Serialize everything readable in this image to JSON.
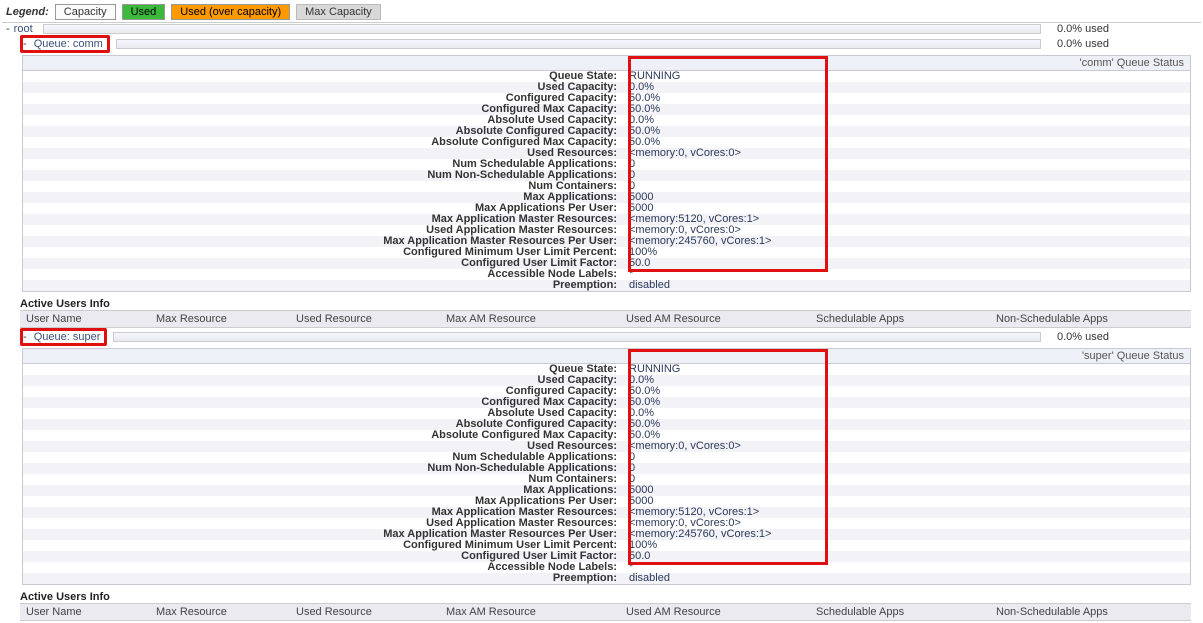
{
  "legend": {
    "title": "Legend:",
    "chips": {
      "capacity": "Capacity",
      "used": "Used",
      "over": "Used (over capacity)",
      "max": "Max Capacity"
    }
  },
  "tree": {
    "root": {
      "toggle": "-",
      "label": "root",
      "used": "0.0% used"
    },
    "queues": [
      {
        "toggle": "-",
        "label": "Queue: comm",
        "used": "0.0% used"
      },
      {
        "toggle": "-",
        "label": "Queue: super",
        "used": "0.0% used"
      }
    ]
  },
  "panels": [
    {
      "title": "'comm' Queue Status",
      "rows": [
        {
          "k": "Queue State:",
          "v": "RUNNING"
        },
        {
          "k": "Used Capacity:",
          "v": "0.0%"
        },
        {
          "k": "Configured Capacity:",
          "v": "50.0%"
        },
        {
          "k": "Configured Max Capacity:",
          "v": "50.0%"
        },
        {
          "k": "Absolute Used Capacity:",
          "v": "0.0%"
        },
        {
          "k": "Absolute Configured Capacity:",
          "v": "50.0%"
        },
        {
          "k": "Absolute Configured Max Capacity:",
          "v": "50.0%"
        },
        {
          "k": "Used Resources:",
          "v": "<memory:0, vCores:0>"
        },
        {
          "k": "Num Schedulable Applications:",
          "v": "0"
        },
        {
          "k": "Num Non-Schedulable Applications:",
          "v": "0"
        },
        {
          "k": "Num Containers:",
          "v": "0"
        },
        {
          "k": "Max Applications:",
          "v": "5000"
        },
        {
          "k": "Max Applications Per User:",
          "v": "5000"
        },
        {
          "k": "Max Application Master Resources:",
          "v": "<memory:5120, vCores:1>"
        },
        {
          "k": "Used Application Master Resources:",
          "v": "<memory:0, vCores:0>"
        },
        {
          "k": "Max Application Master Resources Per User:",
          "v": "<memory:245760, vCores:1>"
        },
        {
          "k": "Configured Minimum User Limit Percent:",
          "v": "100%"
        },
        {
          "k": "Configured User Limit Factor:",
          "v": "50.0"
        },
        {
          "k": "Accessible Node Labels:",
          "v": "*"
        },
        {
          "k": "Preemption:",
          "v": "disabled"
        }
      ]
    },
    {
      "title": "'super' Queue Status",
      "rows": [
        {
          "k": "Queue State:",
          "v": "RUNNING"
        },
        {
          "k": "Used Capacity:",
          "v": "0.0%"
        },
        {
          "k": "Configured Capacity:",
          "v": "50.0%"
        },
        {
          "k": "Configured Max Capacity:",
          "v": "50.0%"
        },
        {
          "k": "Absolute Used Capacity:",
          "v": "0.0%"
        },
        {
          "k": "Absolute Configured Capacity:",
          "v": "50.0%"
        },
        {
          "k": "Absolute Configured Max Capacity:",
          "v": "50.0%"
        },
        {
          "k": "Used Resources:",
          "v": "<memory:0, vCores:0>"
        },
        {
          "k": "Num Schedulable Applications:",
          "v": "0"
        },
        {
          "k": "Num Non-Schedulable Applications:",
          "v": "0"
        },
        {
          "k": "Num Containers:",
          "v": "0"
        },
        {
          "k": "Max Applications:",
          "v": "5000"
        },
        {
          "k": "Max Applications Per User:",
          "v": "5000"
        },
        {
          "k": "Max Application Master Resources:",
          "v": "<memory:5120, vCores:1>"
        },
        {
          "k": "Used Application Master Resources:",
          "v": "<memory:0, vCores:0>"
        },
        {
          "k": "Max Application Master Resources Per User:",
          "v": "<memory:245760, vCores:1>"
        },
        {
          "k": "Configured Minimum User Limit Percent:",
          "v": "100%"
        },
        {
          "k": "Configured User Limit Factor:",
          "v": "50.0"
        },
        {
          "k": "Accessible Node Labels:",
          "v": "*"
        },
        {
          "k": "Preemption:",
          "v": "disabled"
        }
      ]
    }
  ],
  "activeUsers": {
    "header": "Active Users Info",
    "cols": [
      "User Name",
      "Max Resource",
      "Used Resource",
      "Max AM Resource",
      "Used AM Resource",
      "Schedulable Apps",
      "Non-Schedulable Apps"
    ]
  }
}
